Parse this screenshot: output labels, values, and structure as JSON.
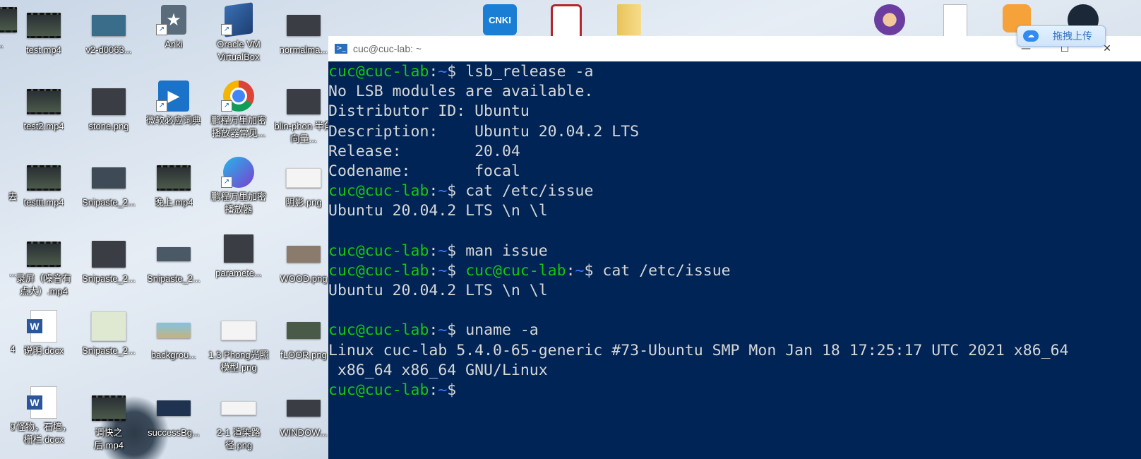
{
  "desktop": {
    "icons": [
      {
        "label": "...",
        "id": "c0r0"
      },
      {
        "label": "test.mp4"
      },
      {
        "label": "v2-d0063..."
      },
      {
        "label": "Anki"
      },
      {
        "label": "Oracle VM VirtualBox"
      },
      {
        "label": "normalma..."
      },
      {
        "label": "test2.mp4"
      },
      {
        "label": "stone.png"
      },
      {
        "label": "微软必应词典"
      },
      {
        "label": "鹏程万里加密播放器常见..."
      },
      {
        "label": "blin-phon 半角向量..."
      },
      {
        "label": "去"
      },
      {
        "label": "testtt.mp4"
      },
      {
        "label": "Snipaste_2..."
      },
      {
        "label": "晚上.mp4"
      },
      {
        "label": "鹏程万里加密播放器"
      },
      {
        "label": "阴影.png"
      },
      {
        "label": "..."
      },
      {
        "label": "录屏（噪音有点大）.mp4"
      },
      {
        "label": "Snipaste_2..."
      },
      {
        "label": "Snipaste_2..."
      },
      {
        "label": "paramete..."
      },
      {
        "label": "WOOD.png"
      },
      {
        "label": "4"
      },
      {
        "label": "说明.docx"
      },
      {
        "label": "Snipaste_2..."
      },
      {
        "label": "backgrou..."
      },
      {
        "label": "1.3 Phong光照模型.png"
      },
      {
        "label": "fLOOR.png"
      },
      {
        "label": "g"
      },
      {
        "label": "怪物，石墙，栅栏.docx"
      },
      {
        "label": "调快之后.mp4"
      },
      {
        "label": "successBg..."
      },
      {
        "label": "2-1 渲染路径.png"
      },
      {
        "label": "WINDOW..."
      }
    ],
    "top_icons": [
      "cnki-icon",
      "red-app-icon",
      "folder-icon",
      "avatar-app-icon",
      "file-icon",
      "fox-app-icon",
      "steam-icon"
    ],
    "cnki_text": "CNKI",
    "upload_label": "拖拽上传"
  },
  "terminal": {
    "title": "cuc@cuc-lab: ~",
    "lines": [
      {
        "user": "cuc@cuc-lab",
        "sep": ":",
        "path": "~",
        "dollar": "$ ",
        "text": "lsb_release -a"
      },
      {
        "text": "No LSB modules are available."
      },
      {
        "text": "Distributor ID: Ubuntu"
      },
      {
        "text": "Description:    Ubuntu 20.04.2 LTS"
      },
      {
        "text": "Release:        20.04"
      },
      {
        "text": "Codename:       focal"
      },
      {
        "user": "cuc@cuc-lab",
        "sep": ":",
        "path": "~",
        "dollar": "$ ",
        "text": "cat /etc/issue"
      },
      {
        "text": "Ubuntu 20.04.2 LTS \\n \\l"
      },
      {
        "text": ""
      },
      {
        "user": "cuc@cuc-lab",
        "sep": ":",
        "path": "~",
        "dollar": "$ ",
        "text": "man issue"
      },
      {
        "user": "cuc@cuc-lab",
        "sep": ":",
        "path": "~",
        "dollar": "$ ",
        "user2": "cuc@cuc-lab",
        "sep2": ":",
        "path2": "~",
        "dollar2": "$ ",
        "text": "cat /etc/issue"
      },
      {
        "text": "Ubuntu 20.04.2 LTS \\n \\l"
      },
      {
        "text": ""
      },
      {
        "user": "cuc@cuc-lab",
        "sep": ":",
        "path": "~",
        "dollar": "$ ",
        "text": "uname -a"
      },
      {
        "text": "Linux cuc-lab 5.4.0-65-generic #73-Ubuntu SMP Mon Jan 18 17:25:17 UTC 2021 x86_64"
      },
      {
        "text": " x86_64 x86_64 GNU/Linux"
      },
      {
        "user": "cuc@cuc-lab",
        "sep": ":",
        "path": "~",
        "dollar": "$",
        "text": ""
      }
    ],
    "minimize": "—",
    "maximize": "☐",
    "close": "✕"
  }
}
